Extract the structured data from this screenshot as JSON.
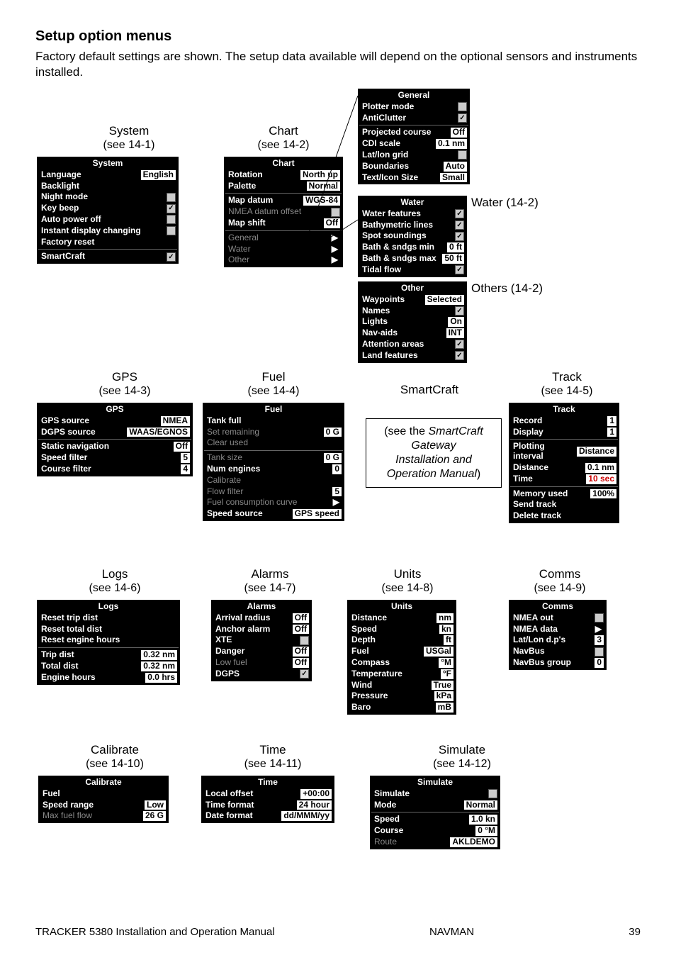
{
  "page": {
    "title": "Setup option menus",
    "intro": "Factory default settings are shown. The setup data available will depend on the optional sensors and instruments installed.",
    "footer_left": "TRACKER 5380  Installation and Operation Manual",
    "footer_center": "NAVMAN",
    "footer_right": "39"
  },
  "labels": {
    "system": "System",
    "system_sub": "(see 14-1)",
    "chart": "Chart",
    "chart_sub": "(see 14-2)",
    "water": "Water (14-2)",
    "others": "Others (14-2)",
    "gps": "GPS",
    "gps_sub": "(see 14-3)",
    "fuel": "Fuel",
    "fuel_sub": "(see 14-4)",
    "smartcraft": "SmartCraft",
    "track": "Track",
    "track_sub": "(see 14-5)",
    "logs": "Logs",
    "logs_sub": "(see 14-6)",
    "alarms": "Alarms",
    "alarms_sub": "(see 14-7)",
    "units": "Units",
    "units_sub": "(see 14-8)",
    "comms": "Comms",
    "comms_sub": "(see 14-9)",
    "calibrate": "Calibrate",
    "calibrate_sub": "(see 14-10)",
    "time": "Time",
    "time_sub": "(see 14-11)",
    "simulate": "Simulate",
    "simulate_sub": "(see 14-12)"
  },
  "smartcraft_note": {
    "l1": "(see the ",
    "l1i": "SmartCraft",
    "l2": "Gateway",
    "l3": "Installation and",
    "l4": "Operation Manual",
    "l4t": ")"
  },
  "menus": {
    "system": {
      "title": "System",
      "rows": [
        {
          "label": "Language",
          "val": "English",
          "type": "val"
        },
        {
          "label": "Backlight",
          "type": "none"
        },
        {
          "label": "Night mode",
          "type": "cb",
          "checked": false
        },
        {
          "label": "Key beep",
          "type": "cb",
          "checked": true
        },
        {
          "label": "Auto power off",
          "type": "cb",
          "checked": false
        },
        {
          "label": "Instant display changing",
          "type": "cb",
          "checked": false
        },
        {
          "label": "Factory reset",
          "type": "none"
        },
        {
          "sep": true
        },
        {
          "label": "SmartCraft",
          "type": "cb",
          "checked": true
        }
      ]
    },
    "chart": {
      "title": "Chart",
      "rows": [
        {
          "label": "Rotation",
          "val": "North up",
          "type": "val"
        },
        {
          "label": "Palette",
          "val": "Normal",
          "type": "val"
        },
        {
          "sep": true
        },
        {
          "label": "Map datum",
          "val": "WGS-84",
          "type": "val"
        },
        {
          "label": "NMEA datum offset",
          "type": "cb",
          "checked": false,
          "dim": true
        },
        {
          "label": "Map shift",
          "val": "Off",
          "type": "val"
        },
        {
          "sep": true
        },
        {
          "label": "General",
          "type": "arrow",
          "dim": true
        },
        {
          "label": "Water",
          "type": "arrow",
          "dim": true
        },
        {
          "label": "Other",
          "type": "arrow",
          "dim": true
        }
      ]
    },
    "general": {
      "title": "General",
      "rows": [
        {
          "label": "Plotter mode",
          "type": "cb",
          "checked": false
        },
        {
          "label": "AntiClutter",
          "type": "cb",
          "checked": true
        },
        {
          "sep": true
        },
        {
          "label": "Projected course",
          "val": "Off",
          "type": "val"
        },
        {
          "label": "CDI scale",
          "val": "0.1   nm",
          "type": "val"
        },
        {
          "label": "Lat/lon grid",
          "type": "cb",
          "checked": false
        },
        {
          "label": "Boundaries",
          "val": "Auto",
          "type": "val"
        },
        {
          "label": "Text/Icon Size",
          "val": "Small",
          "type": "val"
        }
      ]
    },
    "water": {
      "title": "Water",
      "rows": [
        {
          "label": "Water features",
          "type": "cb",
          "checked": true
        },
        {
          "label": "Bathymetric lines",
          "type": "cb",
          "checked": true
        },
        {
          "label": "Spot soundings",
          "type": "cb",
          "checked": true
        },
        {
          "label": "Bath & sndgs min",
          "val": "0 ft",
          "type": "val"
        },
        {
          "label": "Bath & sndgs max",
          "val": "50 ft",
          "type": "val"
        },
        {
          "label": "Tidal flow",
          "type": "cb",
          "checked": true
        }
      ]
    },
    "other": {
      "title": "Other",
      "rows": [
        {
          "label": "Waypoints",
          "val": "Selected",
          "type": "val"
        },
        {
          "label": "Names",
          "type": "cb",
          "checked": true
        },
        {
          "label": "Lights",
          "val": "On",
          "type": "val"
        },
        {
          "label": "Nav-aids",
          "val": "INT",
          "type": "val"
        },
        {
          "label": "Attention areas",
          "type": "cb",
          "checked": true
        },
        {
          "label": "Land features",
          "type": "cb",
          "checked": true
        }
      ]
    },
    "gps": {
      "title": "GPS",
      "rows": [
        {
          "label": "GPS source",
          "val": "NMEA",
          "type": "val"
        },
        {
          "label": "DGPS source",
          "val": "WAAS/EGNOS",
          "type": "val"
        },
        {
          "sep": true
        },
        {
          "label": "Static navigation",
          "val": "Off",
          "type": "val"
        },
        {
          "label": "Speed filter",
          "val": "5",
          "type": "val"
        },
        {
          "label": "Course filter",
          "val": "4",
          "type": "val"
        }
      ]
    },
    "fuel": {
      "title": "Fuel",
      "rows": [
        {
          "label": "Tank full",
          "type": "none"
        },
        {
          "label": "Set remaining",
          "val": "0 G",
          "type": "val",
          "dim": true
        },
        {
          "label": "Clear used",
          "type": "none",
          "dim": true
        },
        {
          "sep": true
        },
        {
          "label": "Tank size",
          "val": "0 G",
          "type": "val",
          "dim": true
        },
        {
          "label": "Num engines",
          "val": "0",
          "type": "val"
        },
        {
          "label": "Calibrate",
          "type": "none",
          "dim": true
        },
        {
          "label": "Flow filter",
          "val": "5",
          "type": "val",
          "dim": true
        },
        {
          "label": "Fuel consumption curve",
          "type": "arrow",
          "dim": true
        },
        {
          "label": "Speed source",
          "val": "GPS speed",
          "type": "val"
        }
      ]
    },
    "track": {
      "title": "Track",
      "rows": [
        {
          "label": "Record",
          "val": "1",
          "type": "val"
        },
        {
          "label": "Display",
          "val": "1",
          "type": "val"
        },
        {
          "sep": true
        },
        {
          "label": "Plotting interval",
          "val": "Distance",
          "type": "val"
        },
        {
          "label": "Distance",
          "val": "0.1 nm",
          "type": "val"
        },
        {
          "label": "Time",
          "val": "10 sec",
          "type": "val",
          "valred": true
        },
        {
          "sep": true
        },
        {
          "label": "Memory used",
          "val": "100%",
          "type": "val"
        },
        {
          "label": "Send track",
          "type": "none"
        },
        {
          "label": "Delete track",
          "type": "none"
        }
      ]
    },
    "logs": {
      "title": "Logs",
      "rows": [
        {
          "label": "Reset trip dist",
          "type": "none"
        },
        {
          "label": "Reset total dist",
          "type": "none"
        },
        {
          "label": "Reset engine hours",
          "type": "none"
        },
        {
          "sep": true
        },
        {
          "label": "Trip dist",
          "val": "0.32 nm",
          "type": "val"
        },
        {
          "label": "Total dist",
          "val": "0.32 nm",
          "type": "val"
        },
        {
          "label": "Engine hours",
          "val": "0.0 hrs",
          "type": "val"
        }
      ]
    },
    "alarms": {
      "title": "Alarms",
      "rows": [
        {
          "label": "Arrival radius",
          "val": "Off",
          "type": "val"
        },
        {
          "label": "Anchor alarm",
          "val": "Off",
          "type": "val"
        },
        {
          "label": "XTE",
          "type": "cb",
          "checked": false
        },
        {
          "label": "Danger",
          "val": "Off",
          "type": "val"
        },
        {
          "label": "Low fuel",
          "val": "Off",
          "type": "val",
          "dim": true
        },
        {
          "label": "DGPS",
          "type": "cb",
          "checked": true
        }
      ]
    },
    "units": {
      "title": "Units",
      "rows": [
        {
          "label": "Distance",
          "val": "nm",
          "type": "val"
        },
        {
          "label": "Speed",
          "val": "kn",
          "type": "val"
        },
        {
          "label": "Depth",
          "val": "ft",
          "type": "val"
        },
        {
          "label": "Fuel",
          "val": "USGal",
          "type": "val"
        },
        {
          "label": "Compass",
          "val": "°M",
          "type": "val"
        },
        {
          "label": "Temperature",
          "val": "°F",
          "type": "val"
        },
        {
          "label": "Wind",
          "val": "True",
          "type": "val"
        },
        {
          "label": "Pressure",
          "val": "kPa",
          "type": "val"
        },
        {
          "label": "Baro",
          "val": "mB",
          "type": "val"
        }
      ]
    },
    "comms": {
      "title": "Comms",
      "rows": [
        {
          "label": "NMEA out",
          "type": "cb",
          "checked": false
        },
        {
          "label": "NMEA data",
          "type": "arrow"
        },
        {
          "label": "Lat/Lon d.p's",
          "val": "3",
          "type": "val"
        },
        {
          "label": "NavBus",
          "type": "cb",
          "checked": false
        },
        {
          "label": "NavBus group",
          "val": "0",
          "type": "val"
        }
      ]
    },
    "calibrate": {
      "title": "Calibrate",
      "rows": [
        {
          "label": "Fuel",
          "type": "none"
        },
        {
          "label": "Speed range",
          "val": "Low",
          "type": "val"
        },
        {
          "label": "Max fuel flow",
          "val": "26 G",
          "type": "val",
          "dim": true
        }
      ]
    },
    "time": {
      "title": "Time",
      "rows": [
        {
          "label": "Local offset",
          "val": "+00:00",
          "type": "val"
        },
        {
          "label": "Time format",
          "val": "24 hour",
          "type": "val"
        },
        {
          "label": "Date format",
          "val": "dd/MMM/yy",
          "type": "val"
        }
      ]
    },
    "simulate": {
      "title": "Simulate",
      "rows": [
        {
          "label": "Simulate",
          "type": "cb",
          "checked": false
        },
        {
          "label": "Mode",
          "val": "Normal",
          "type": "val"
        },
        {
          "sep": true
        },
        {
          "label": "Speed",
          "val": "1.0 kn",
          "type": "val"
        },
        {
          "label": "Course",
          "val": "0 °M",
          "type": "val"
        },
        {
          "label": "Route",
          "val": "AKLDEMO",
          "type": "val",
          "dim": true
        }
      ]
    }
  }
}
